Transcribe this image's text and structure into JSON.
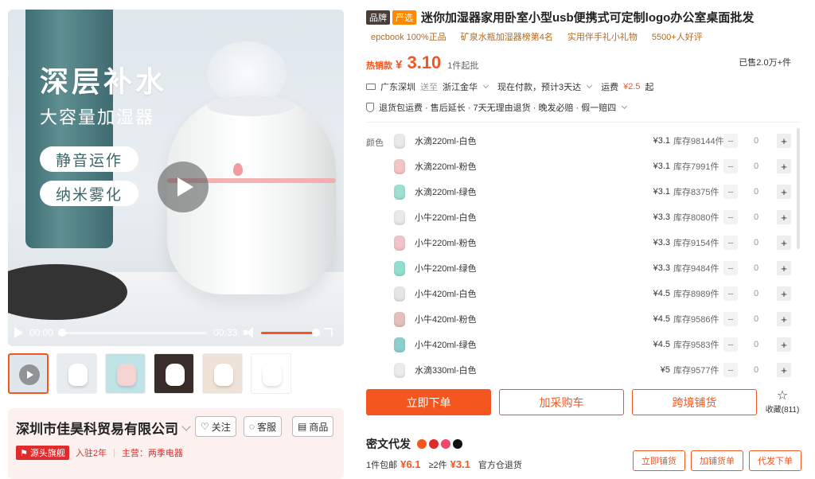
{
  "media": {
    "promo_title": "深层补水",
    "promo_subtitle": "大容量加湿器",
    "pills": [
      "静音运作",
      "纳米雾化"
    ],
    "current_time": "00:00",
    "duration": "00:33",
    "playback_progress": 0,
    "volume_level": 1.0
  },
  "thumbnails": [
    {
      "kind": "video",
      "bg": "#dfe7ec"
    },
    {
      "kind": "image",
      "bg": "#e8ecee"
    },
    {
      "kind": "image",
      "bg": "#bfe3e6"
    },
    {
      "kind": "image",
      "bg": "#3a2e2a"
    },
    {
      "kind": "image",
      "bg": "#efe2d6"
    },
    {
      "kind": "image",
      "bg": "#ffffff"
    }
  ],
  "shop": {
    "name": "深圳市佳昊科贸易有限公司",
    "follow_label": "关注",
    "service_label": "客服",
    "products_label": "商品",
    "source_badge": "源头旗舰",
    "years": "入驻2年",
    "main_business": "主营：两季电器"
  },
  "product": {
    "badge_brand": "品牌",
    "badge_strict": "严选",
    "title": "迷你加湿器家用卧室小型usb便携式可定制logo办公室桌面批发",
    "tags": [
      "epcbook 100%正品",
      "矿泉水瓶加湿器榜第4名",
      "实用伴手礼小礼物",
      "5500+人好评"
    ],
    "hot_label": "热销款",
    "currency": "¥",
    "price": "3.10",
    "moq": "1件起批",
    "sold": "已售2.0万+件",
    "ship_from": "广东深圳",
    "ship_to_label": "送至",
    "ship_to": "浙江金华",
    "delivery": "现在付款，预计3天达",
    "freight_label": "运费",
    "freight": "¥2.5",
    "freight_suffix": "起",
    "services": "退货包运费 · 售后延长 · 7天无理由退货 · 晚发必赔 · 假一赔四",
    "color_label": "颜色",
    "skus": [
      {
        "name": "水滴220ml-白色",
        "price": "¥3.1",
        "stock": "库存98144件",
        "qty": "0",
        "color": "#e9e9e9"
      },
      {
        "name": "水滴220ml-粉色",
        "price": "¥3.1",
        "stock": "库存7991件",
        "qty": "0",
        "color": "#f2c6c4"
      },
      {
        "name": "水滴220ml-绿色",
        "price": "¥3.1",
        "stock": "库存8375件",
        "qty": "0",
        "color": "#9fe0d3"
      },
      {
        "name": "小牛220ml-白色",
        "price": "¥3.3",
        "stock": "库存8080件",
        "qty": "0",
        "color": "#e9e9e9"
      },
      {
        "name": "小牛220ml-粉色",
        "price": "¥3.3",
        "stock": "库存9154件",
        "qty": "0",
        "color": "#f0c4c8"
      },
      {
        "name": "小牛220ml-绿色",
        "price": "¥3.3",
        "stock": "库存9484件",
        "qty": "0",
        "color": "#92dfd2"
      },
      {
        "name": "小牛420ml-白色",
        "price": "¥4.5",
        "stock": "库存8989件",
        "qty": "0",
        "color": "#e5e5e5"
      },
      {
        "name": "小牛420ml-粉色",
        "price": "¥4.5",
        "stock": "库存9586件",
        "qty": "0",
        "color": "#e4c0bd"
      },
      {
        "name": "小牛420ml-绿色",
        "price": "¥4.5",
        "stock": "库存9583件",
        "qty": "0",
        "color": "#8ccfcc"
      },
      {
        "name": "水滴330ml-白色",
        "price": "¥5",
        "stock": "库存9577件",
        "qty": "0",
        "color": "#ececec"
      }
    ],
    "buy_now": "立即下单",
    "add_cart": "加采购车",
    "cross_border": "跨境铺货",
    "favorite_label": "收藏",
    "favorite_count": "(811)"
  },
  "dropship": {
    "title": "密文代发",
    "logo_colors": [
      "#f3571f",
      "#e02b2b",
      "#f04a6b",
      "#111111"
    ],
    "tier1_label": "1件包邮",
    "tier1_price": "¥6.1",
    "tier2_label": "≥2件",
    "tier2_price": "¥3.1",
    "warehouse": "官方仓退货",
    "btn_list": "立即铺货",
    "btn_add": "加铺货单",
    "btn_order": "代发下单"
  },
  "colors": {
    "accent": "#f3571f",
    "red": "#e02b2b"
  }
}
